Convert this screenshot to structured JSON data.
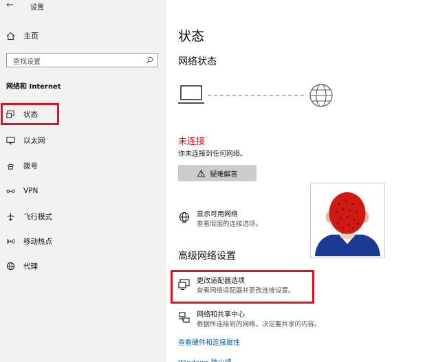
{
  "window": {
    "back_glyph": "←",
    "title": "设置"
  },
  "sidebar": {
    "home_label": "主页",
    "search_placeholder": "查找设置",
    "section_heading": "网络和 Internet",
    "items": [
      {
        "label": "状态",
        "icon": "status-icon"
      },
      {
        "label": "以太网",
        "icon": "ethernet-icon"
      },
      {
        "label": "拨号",
        "icon": "dialup-icon"
      },
      {
        "label": "VPN",
        "icon": "vpn-icon"
      },
      {
        "label": "飞行模式",
        "icon": "airplane-icon"
      },
      {
        "label": "移动热点",
        "icon": "hotspot-icon"
      },
      {
        "label": "代理",
        "icon": "globe-icon"
      }
    ]
  },
  "main": {
    "title": "状态",
    "network_status_heading": "网络状态",
    "connection_state": "未连接",
    "connection_desc": "你未连接到任何网络。",
    "troubleshoot_label": "疑难解答",
    "show_networks": {
      "title": "显示可用网络",
      "desc": "查看周围的连接选项。"
    },
    "advanced_heading": "高级网络设置",
    "adapter_options": {
      "title": "更改适配器选项",
      "desc": "查看网络适配器并更改连接设置。"
    },
    "sharing_center": {
      "title": "网络和共享中心",
      "desc": "根据所连接到的网络，决定要共享的内容。"
    },
    "hardware_link": "查看硬件和连接属性",
    "firewall_link": "Windows 防火墙"
  },
  "colors": {
    "accent_red": "#e01020",
    "error_text": "#d1111c",
    "link": "#0066b4",
    "sidebar_bg": "#f2f2f2"
  }
}
